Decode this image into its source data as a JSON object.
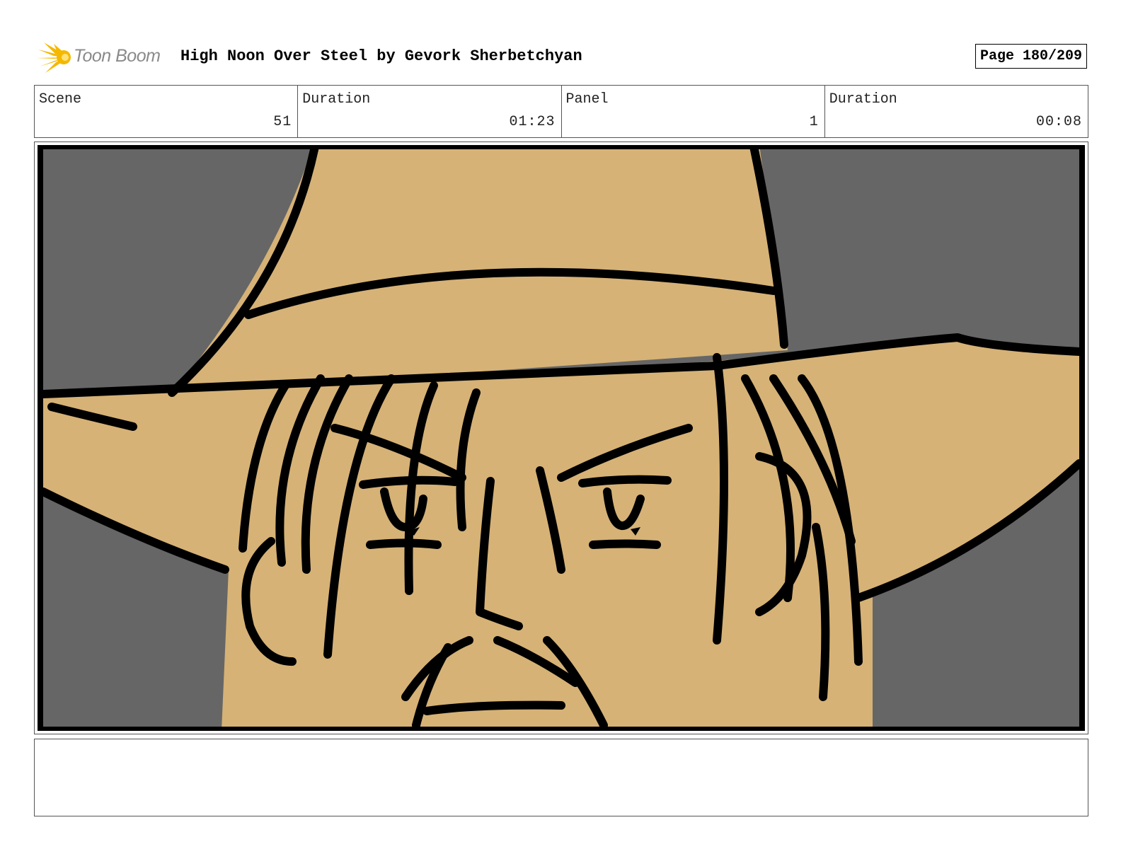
{
  "header": {
    "logo_text": "Toon Boom",
    "title": "High Noon Over Steel by Gevork Sherbetchyan",
    "page": "Page 180/209"
  },
  "info": {
    "scene_label": "Scene",
    "scene_value": "51",
    "scene_duration_label": "Duration",
    "scene_duration_value": "01:23",
    "panel_label": "Panel",
    "panel_value": "1",
    "panel_duration_label": "Duration",
    "panel_duration_value": "00:08"
  },
  "panel": {
    "background_color": "#666666",
    "skin_color": "#D6B276",
    "line_color": "#000000"
  },
  "notes": {
    "text": ""
  }
}
